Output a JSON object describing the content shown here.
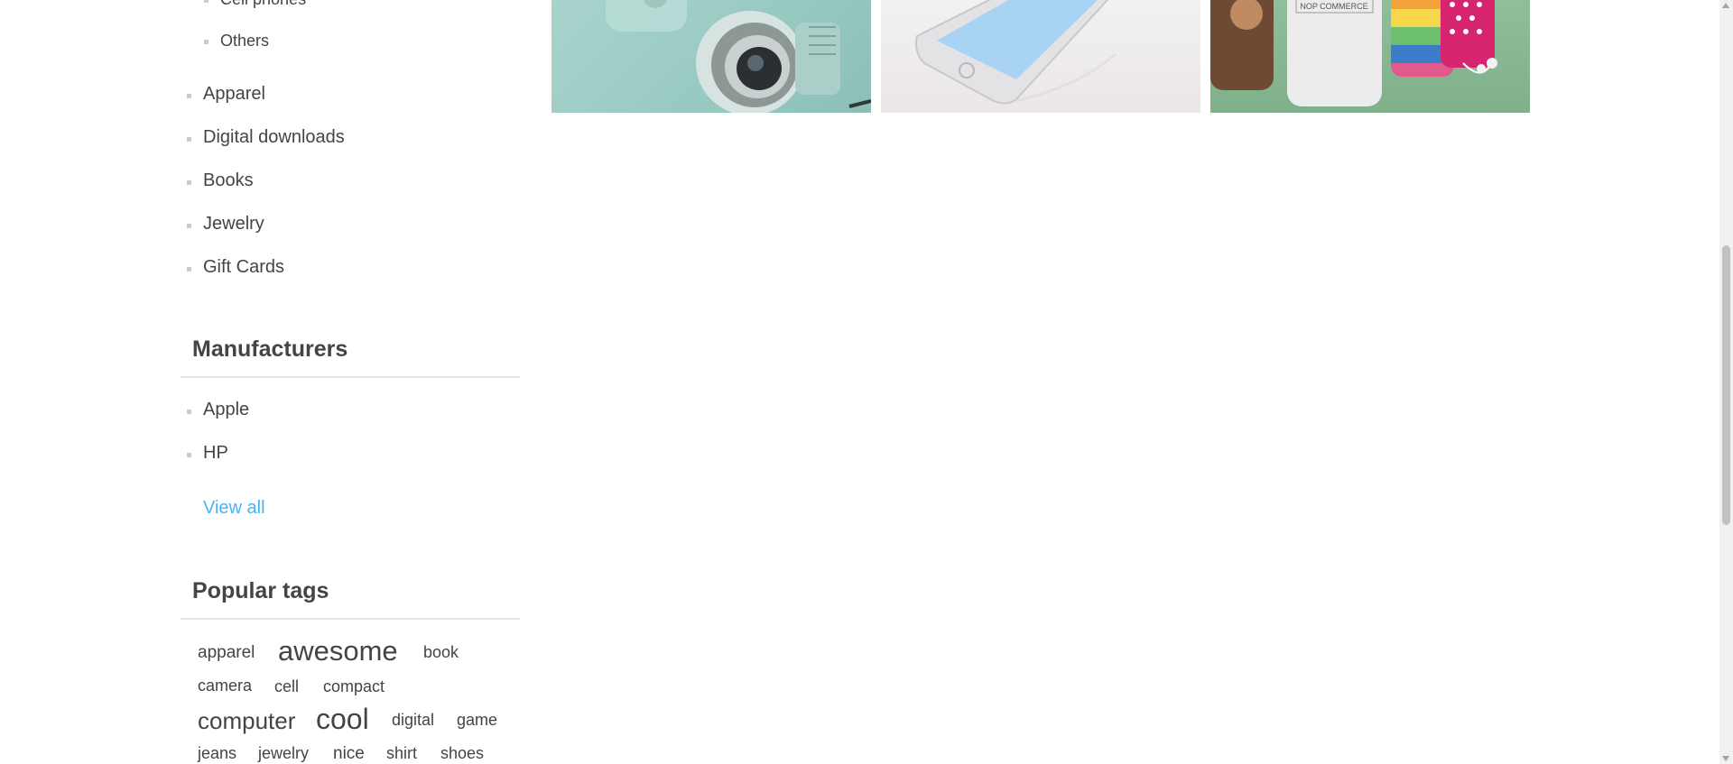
{
  "categories": {
    "sub_items": [
      "Cell phones",
      "Others"
    ],
    "items": [
      "Apparel",
      "Digital downloads",
      "Books",
      "Jewelry",
      "Gift Cards"
    ]
  },
  "manufacturers": {
    "title": "Manufacturers",
    "items": [
      "Apple",
      "HP"
    ],
    "view_all": "View all"
  },
  "popular_tags": {
    "title": "Popular tags",
    "tags": [
      "apparel",
      "awesome",
      "book",
      "camera",
      "cell",
      "compact",
      "computer",
      "cool",
      "digital",
      "game",
      "jeans",
      "jewelry",
      "nice",
      "shirt",
      "shoes"
    ]
  },
  "products": {
    "image_label": "NOP COMMERCE"
  },
  "colors": {
    "link": "#4ab2f1",
    "text": "#444444",
    "bullet": "#cccccc"
  }
}
